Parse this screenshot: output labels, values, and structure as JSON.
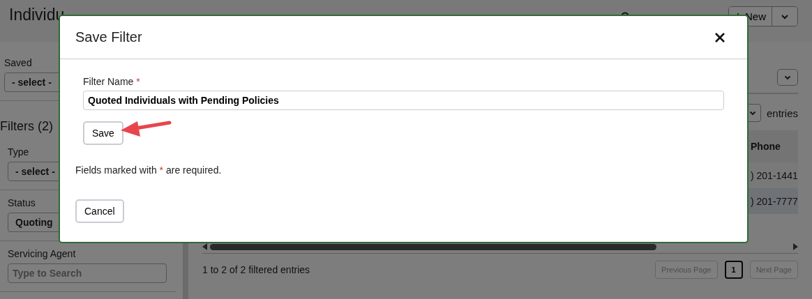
{
  "page": {
    "title": "Individu",
    "new_button": "New"
  },
  "sidebar": {
    "saved": {
      "label": "Saved",
      "value": "- select -"
    },
    "filters_heading": "Filters (2)",
    "filters": [
      {
        "kind": "select",
        "label": "Type",
        "value": "- select -"
      },
      {
        "kind": "select",
        "label": "Status",
        "value": "Quoting"
      },
      {
        "kind": "search",
        "label": "Servicing Agent",
        "placeholder": "Type to Search"
      }
    ]
  },
  "main": {
    "entries_label": "entries",
    "table": {
      "columns": [
        "Phone"
      ],
      "rows": [
        [
          ") 201-1441"
        ],
        [
          ") 201-7777"
        ]
      ]
    },
    "summary": "1 to 2 of 2 filtered entries",
    "pagination": {
      "previous": {
        "label": "Previous Page",
        "disabled": true
      },
      "pages": [
        {
          "label": "1",
          "selected": true
        }
      ],
      "next": {
        "label": "Next Page",
        "disabled": true
      }
    }
  },
  "dialog": {
    "title": "Save Filter",
    "fields": [
      {
        "label": "Filter Name",
        "required_mark": "*",
        "value": "Quoted Individuals with Pending Policies"
      }
    ],
    "save_button": "Save",
    "note": {
      "before": "Fields marked with",
      "mark": "*",
      "after": "are required."
    },
    "cancel_button": "Cancel"
  }
}
